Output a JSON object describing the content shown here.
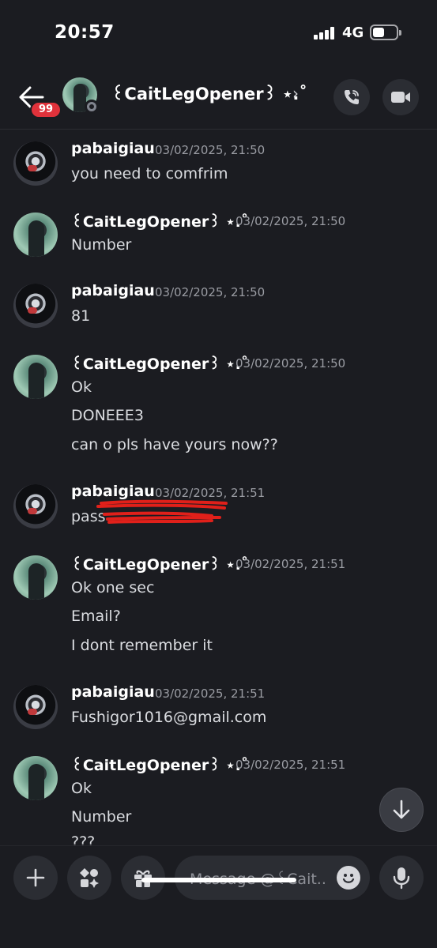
{
  "status_bar": {
    "time": "20:57",
    "network": "4G"
  },
  "header": {
    "unread_count": "99",
    "contact_name": "꒰CaitLegOpener꒱ ⋆.˚",
    "chevron": "›"
  },
  "messages": [
    {
      "author": "pabaigiau",
      "timestamp": "03/02/2025, 21:50",
      "lines": [
        "you need to comfrim"
      ]
    },
    {
      "author": "꒰CaitLegOpener꒱ ⋆.˚",
      "timestamp": "03/02/2025, 21:50",
      "lines": [
        "Number"
      ]
    },
    {
      "author": "pabaigiau",
      "timestamp": "03/02/2025, 21:50",
      "lines": [
        "81"
      ]
    },
    {
      "author": "꒰CaitLegOpener꒱ ⋆.˚",
      "timestamp": "03/02/2025, 21:50",
      "lines": [
        "Ok",
        "DONEEE3",
        "can o pls have yours now??"
      ]
    },
    {
      "author": "pabaigiau",
      "timestamp": "03/02/2025, 21:51",
      "lines": [
        "pass"
      ]
    },
    {
      "author": "꒰CaitLegOpener꒱ ⋆.˚",
      "timestamp": "03/02/2025, 21:51",
      "lines": [
        "Ok one sec",
        "Email?",
        "I dont remember it"
      ]
    },
    {
      "author": "pabaigiau",
      "timestamp": "03/02/2025, 21:51",
      "lines": [
        "Fushigor1016@gmail.com"
      ]
    },
    {
      "author": "꒰CaitLegOpener꒱ ⋆.˚",
      "timestamp": "03/02/2025, 21:51",
      "lines": [
        "Ok",
        "Number",
        "???"
      ]
    }
  ],
  "composer": {
    "placeholder": "Message @꒰Cait.."
  },
  "colors": {
    "background": "#1b1c21",
    "badge": "#e0323b",
    "redaction": "#e0201a",
    "timestamp": "#9a9ca3"
  },
  "icons": [
    "back-arrow-icon",
    "call-icon",
    "video-icon",
    "arrow-down-icon",
    "plus-icon",
    "apps-icon",
    "gift-icon",
    "emoji-icon",
    "microphone-icon"
  ]
}
